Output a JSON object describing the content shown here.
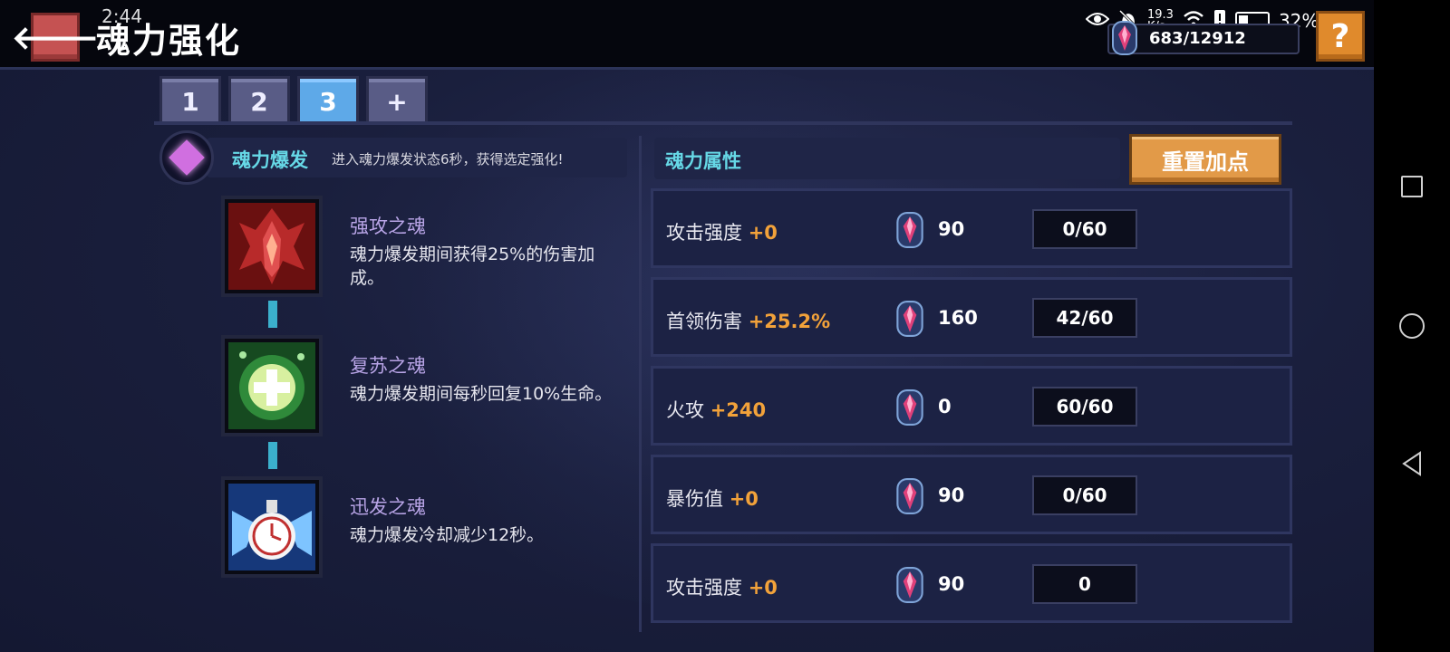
{
  "header": {
    "back_label": "🡐",
    "title": "魂力强化",
    "clock": "2:44",
    "currency_value": "683/12912",
    "help_label": "?",
    "close_label": "✕"
  },
  "status_bar": {
    "network_speed_value": "19.3",
    "network_speed_unit": "K/s",
    "battery_percent": "32%",
    "battery_level": 0.32
  },
  "tabs": [
    {
      "label": "1",
      "active": false
    },
    {
      "label": "2",
      "active": false
    },
    {
      "label": "3",
      "active": true
    },
    {
      "label": "+",
      "active": false
    }
  ],
  "burst": {
    "title": "魂力爆发",
    "description": "进入魂力爆发状态6秒，获得选定强化!"
  },
  "skills": [
    {
      "name": "强攻之魂",
      "description": "魂力爆发期间获得25%的伤害加成。",
      "icon": "red-attack-soul-icon",
      "color": "#b82a2a"
    },
    {
      "name": "复苏之魂",
      "description": "魂力爆发期间每秒回复10%生命。",
      "icon": "green-heal-soul-icon",
      "color": "#2f8a3a"
    },
    {
      "name": "迅发之魂",
      "description": "魂力爆发冷却减少12秒。",
      "icon": "blue-clock-soul-icon",
      "color": "#3a7ad8"
    }
  ],
  "attributes": {
    "title": "魂力属性",
    "reset_label": "重置加点",
    "rows": [
      {
        "name": "攻击强度",
        "bonus": "+0",
        "cost": "90",
        "level": "0/60"
      },
      {
        "name": "首领伤害",
        "bonus": "+25.2%",
        "cost": "160",
        "level": "42/60"
      },
      {
        "name": "火攻",
        "bonus": "+240",
        "cost": "0",
        "level": "60/60"
      },
      {
        "name": "暴伤值",
        "bonus": "+0",
        "cost": "90",
        "level": "0/60"
      },
      {
        "name": "攻击强度",
        "bonus": "+0",
        "cost": "90",
        "level": "0"
      }
    ]
  },
  "colors": {
    "accent_cyan": "#66d8e6",
    "bonus_orange": "#f2a23a",
    "tab_active": "#5ea9e8",
    "reset_button": "#e29a48"
  },
  "icons": {
    "soul_gem": "soul-gem-icon",
    "eye": "eye-icon",
    "wifi": "wifi-icon",
    "battery": "battery-icon"
  }
}
